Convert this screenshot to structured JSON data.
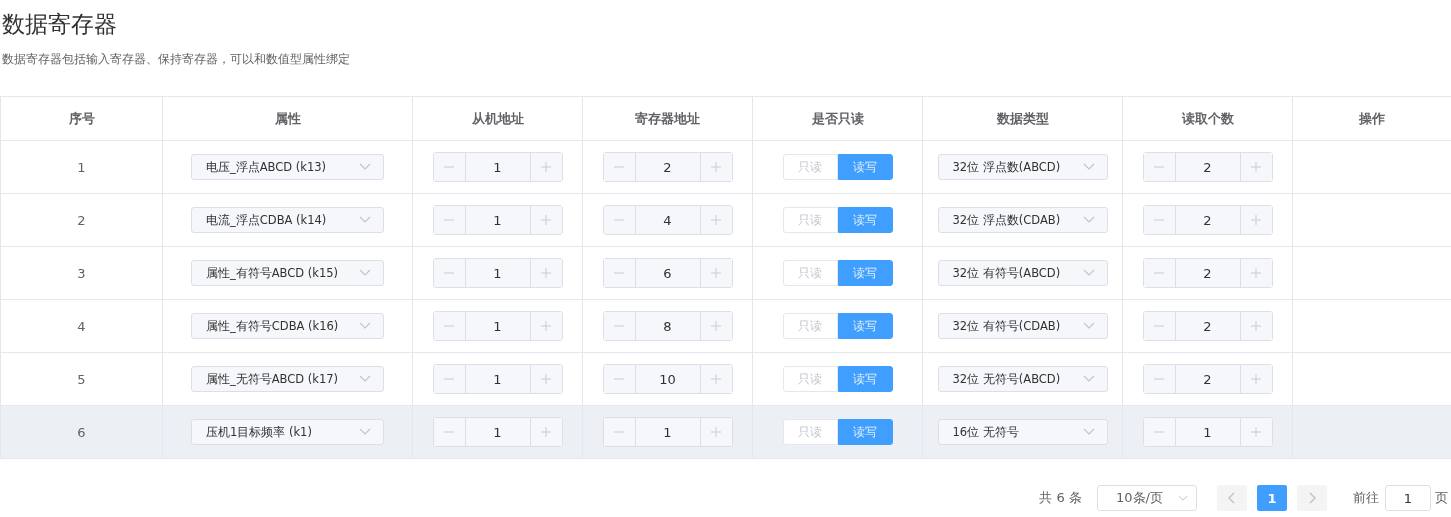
{
  "title": "数据寄存器",
  "description": "数据寄存器包括输入寄存器、保持寄存器，可以和数值型属性绑定",
  "table": {
    "columns": [
      "序号",
      "属性",
      "从机地址",
      "寄存器地址",
      "是否只读",
      "数据类型",
      "读取个数",
      "操作"
    ],
    "rows": [
      {
        "index": "1",
        "attribute": "电压_浮点ABCD (k13)",
        "slave_address": "1",
        "register_address": "2",
        "access": [
          {
            "label": "只读",
            "selected": false
          },
          {
            "label": "读写",
            "selected": true
          }
        ],
        "data_type": "32位 浮点数(ABCD)",
        "count": "2",
        "hovered": false
      },
      {
        "index": "2",
        "attribute": "电流_浮点CDBA (k14)",
        "slave_address": "1",
        "register_address": "4",
        "access": [
          {
            "label": "只读",
            "selected": false
          },
          {
            "label": "读写",
            "selected": true
          }
        ],
        "data_type": "32位 浮点数(CDAB)",
        "count": "2",
        "hovered": false
      },
      {
        "index": "3",
        "attribute": "属性_有符号ABCD (k15)",
        "slave_address": "1",
        "register_address": "6",
        "access": [
          {
            "label": "只读",
            "selected": false
          },
          {
            "label": "读写",
            "selected": true
          }
        ],
        "data_type": "32位 有符号(ABCD)",
        "count": "2",
        "hovered": false
      },
      {
        "index": "4",
        "attribute": "属性_有符号CDBA (k16)",
        "slave_address": "1",
        "register_address": "8",
        "access": [
          {
            "label": "只读",
            "selected": false
          },
          {
            "label": "读写",
            "selected": true
          }
        ],
        "data_type": "32位 有符号(CDAB)",
        "count": "2",
        "hovered": false
      },
      {
        "index": "5",
        "attribute": "属性_无符号ABCD (k17)",
        "slave_address": "1",
        "register_address": "10",
        "access": [
          {
            "label": "只读",
            "selected": false
          },
          {
            "label": "读写",
            "selected": true
          }
        ],
        "data_type": "32位 无符号(ABCD)",
        "count": "2",
        "hovered": false
      },
      {
        "index": "6",
        "attribute": "压机1目标频率 (k1)",
        "slave_address": "1",
        "register_address": "1",
        "access": [
          {
            "label": "只读",
            "selected": false
          },
          {
            "label": "读写",
            "selected": true
          }
        ],
        "data_type": "16位 无符号",
        "count": "1",
        "hovered": true
      }
    ]
  },
  "pagination": {
    "total": "共 6 条",
    "page_size": "10条/页",
    "pages": [
      {
        "label": "1",
        "selected": true
      }
    ],
    "goto_label": "前往",
    "goto_value": "1",
    "goto_suffix": "页"
  }
}
